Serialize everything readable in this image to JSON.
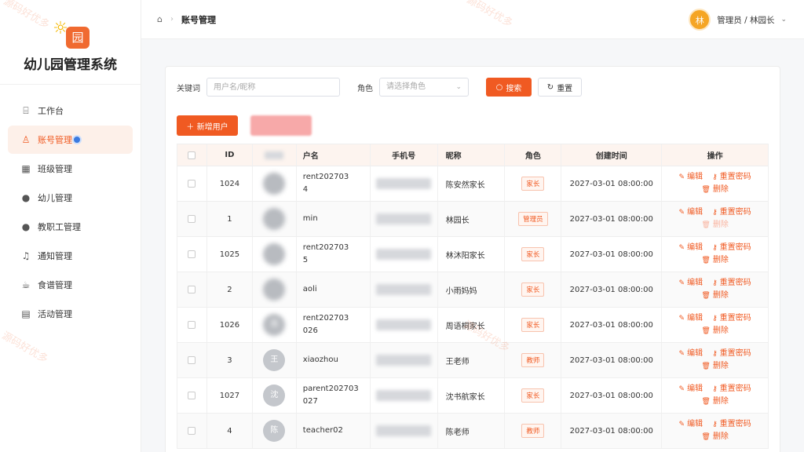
{
  "app": {
    "name": "幼儿园管理系统"
  },
  "sidebar": {
    "items": [
      {
        "label": "工作台",
        "icon": "dashboard-icon",
        "glyph": "⌸",
        "active": false
      },
      {
        "label": "账号管理",
        "icon": "user-icon",
        "glyph": "♙",
        "active": true
      },
      {
        "label": "班级管理",
        "icon": "class-icon",
        "glyph": "▦",
        "active": false
      },
      {
        "label": "幼儿管理",
        "icon": "child-icon",
        "glyph": "●",
        "active": false
      },
      {
        "label": "教职工管理",
        "icon": "staff-icon",
        "glyph": "●",
        "active": false
      },
      {
        "label": "通知管理",
        "icon": "bell-icon",
        "glyph": "♫",
        "active": false
      },
      {
        "label": "食谱管理",
        "icon": "food-icon",
        "glyph": "☕",
        "active": false
      },
      {
        "label": "活动管理",
        "icon": "calendar-icon",
        "glyph": "▤",
        "active": false
      }
    ]
  },
  "header": {
    "breadcrumb_current": "账号管理",
    "user_initial": "林",
    "user_name": "管理员 / 林园长"
  },
  "filters": {
    "keyword_label": "关键词",
    "keyword_placeholder": "用户名/昵称",
    "role_label": "角色",
    "role_placeholder": "请选择角色",
    "search_label": "搜索",
    "reset_label": "重置"
  },
  "actions": {
    "add_label": "新增用户"
  },
  "table": {
    "columns": [
      "ID",
      "",
      "户名",
      "手机号",
      "昵称",
      "角色",
      "创建时间",
      "操作"
    ],
    "rows": [
      {
        "id": "1024",
        "avatar": "",
        "avatar_blurred": true,
        "username": "rent202703\n4",
        "nickname": "陈安然家长",
        "role": "家长",
        "created": "2027-03-01 08:00:00",
        "delete_disabled": false
      },
      {
        "id": "1",
        "avatar": "",
        "avatar_blurred": true,
        "username": "min",
        "nickname": "林园长",
        "role": "管理员",
        "created": "2027-03-01 08:00:00",
        "delete_disabled": true
      },
      {
        "id": "1025",
        "avatar": "",
        "avatar_blurred": true,
        "username": "rent202703\n5",
        "nickname": "林沐阳家长",
        "role": "家长",
        "created": "2027-03-01 08:00:00",
        "delete_disabled": false
      },
      {
        "id": "2",
        "avatar": "",
        "avatar_blurred": true,
        "username": "aoli",
        "nickname": "小雨妈妈",
        "role": "家长",
        "created": "2027-03-01 08:00:00",
        "delete_disabled": false
      },
      {
        "id": "1026",
        "avatar": "周",
        "avatar_blurred": true,
        "username": "rent202703\n026",
        "nickname": "周语桐家长",
        "role": "家长",
        "created": "2027-03-01 08:00:00",
        "delete_disabled": false
      },
      {
        "id": "3",
        "avatar": "王",
        "avatar_blurred": false,
        "username": "xiaozhou",
        "nickname": "王老师",
        "role": "教师",
        "created": "2027-03-01 08:00:00",
        "delete_disabled": false
      },
      {
        "id": "1027",
        "avatar": "沈",
        "avatar_blurred": false,
        "username": "parent202703\n027",
        "nickname": "沈书航家长",
        "role": "家长",
        "created": "2027-03-01 08:00:00",
        "delete_disabled": false
      },
      {
        "id": "4",
        "avatar": "陈",
        "avatar_blurred": false,
        "username": "teacher02",
        "nickname": "陈老师",
        "role": "教师",
        "created": "2027-03-01 08:00:00",
        "delete_disabled": false
      }
    ],
    "op_edit": "编辑",
    "op_reset_password": "重置密码",
    "op_delete": "删除"
  },
  "watermark": "源码好优多",
  "colors": {
    "accent": "#f05a22",
    "active_bg": "#fdf0e9",
    "header_bg": "#fdf4ef"
  }
}
